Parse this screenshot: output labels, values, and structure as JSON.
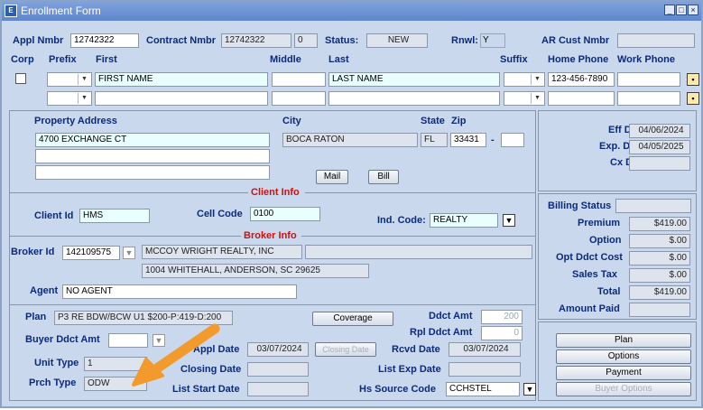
{
  "window": {
    "title": "Enrollment Form"
  },
  "header": {
    "appl_nmbr_label": "Appl Nmbr",
    "appl_nmbr": "12742322",
    "contract_nmbr_label": "Contract Nmbr",
    "contract_nmbr": "12742322",
    "contract_seq": "0",
    "status_label": "Status:",
    "status": "NEW",
    "rnwl_label": "Rnwl:",
    "rnwl": "Y",
    "ar_cust_label": "AR Cust Nmbr",
    "ar_cust": ""
  },
  "names": {
    "col_corp": "Corp",
    "col_prefix": "Prefix",
    "col_first": "First",
    "col_middle": "Middle",
    "col_last": "Last",
    "col_suffix": "Suffix",
    "col_home": "Home Phone",
    "col_work": "Work Phone",
    "row1": {
      "first": "FIRST NAME",
      "middle": "",
      "last": "LAST NAME",
      "home": "123-456-7890",
      "work": ""
    },
    "row2": {
      "first": "",
      "middle": "",
      "last": "",
      "home": "",
      "work": ""
    }
  },
  "property": {
    "address_label": "Property Address",
    "address1": "4700 EXCHANGE CT",
    "address2": "",
    "address3": "",
    "city_label": "City",
    "city": "BOCA RATON",
    "state_label": "State",
    "state": "FL",
    "zip_label": "Zip",
    "zip": "33431",
    "zip_dash": "-",
    "zip4": "",
    "mail_button": "Mail",
    "bill_button": "Bill"
  },
  "dates": {
    "eff_label": "Eff Date:",
    "eff": "04/06/2024",
    "exp_label": "Exp. Date:",
    "exp": "04/05/2025",
    "cx_label": "Cx Date:",
    "cx": ""
  },
  "client": {
    "section": "Client Info",
    "client_id_label": "Client Id",
    "client_id": "HMS",
    "cell_code_label": "Cell Code",
    "cell_code": "0100",
    "ind_code_label": "Ind. Code:",
    "ind_code": "REALTY"
  },
  "broker": {
    "section": "Broker Info",
    "broker_id_label": "Broker Id",
    "broker_id": "142109575",
    "broker_name": "MCCOY WRIGHT REALTY, INC",
    "broker_extra": "",
    "broker_address": "1004 WHITEHALL, ANDERSON, SC 29625",
    "agent_label": "Agent",
    "agent": "NO AGENT"
  },
  "billing": {
    "status_label": "Billing Status",
    "status": "",
    "premium_label": "Premium",
    "premium": "$419.00",
    "option_label": "Option",
    "option": "$.00",
    "opt_ddct_label": "Opt Ddct Cost",
    "opt_ddct": "$.00",
    "sales_tax_label": "Sales Tax",
    "sales_tax": "$.00",
    "total_label": "Total",
    "total": "$419.00",
    "amount_paid_label": "Amount Paid",
    "amount_paid": ""
  },
  "plan": {
    "plan_label": "Plan",
    "plan": "P3 RE BDW/BCW U1 $200-P:419-D:200",
    "coverage_button": "Coverage",
    "ddct_amt_label": "Ddct Amt",
    "ddct_amt": "200",
    "rpl_ddct_label": "Rpl Ddct Amt",
    "rpl_ddct": "0",
    "buyer_ddct_label": "Buyer Ddct Amt",
    "buyer_ddct": "",
    "appl_date_label": "Appl Date",
    "appl_date": "03/07/2024",
    "closing_date_button": "Closing Date",
    "rcvd_date_label": "Rcvd Date",
    "rcvd_date": "03/07/2024",
    "unit_type_label": "Unit Type",
    "unit_type": "1",
    "closing_date_label": "Closing Date",
    "closing_date": "",
    "list_exp_label": "List Exp Date",
    "list_exp": "",
    "prch_type_label": "Prch Type",
    "prch_type": "ODW",
    "list_start_label": "List Start Date",
    "list_start": "",
    "hs_source_label": "Hs Source Code",
    "hs_source": "CCHSTEL"
  },
  "side_buttons": {
    "plan": "Plan",
    "options": "Options",
    "payment": "Payment",
    "buyer_options": "Buyer Options"
  },
  "colors": {
    "annotation_arrow": "#f39a2c",
    "section_red": "#cc1111",
    "label_blue": "#0c2a7a"
  }
}
